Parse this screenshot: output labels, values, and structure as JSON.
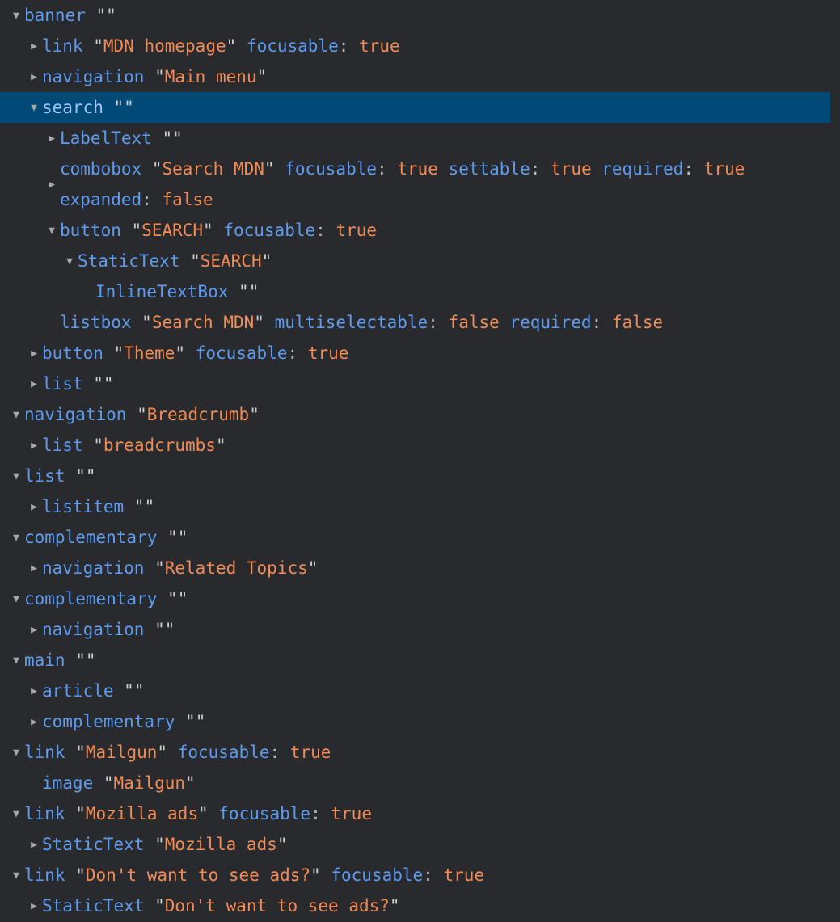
{
  "panel": {
    "name": "accessibility-tree-pane",
    "background_color": "#292a2d",
    "selected_row_color": "#004a77",
    "role_color": "#5e9cf0",
    "value_color": "#f28b54",
    "punctuation_color": "#cfcfcf"
  },
  "icons": {
    "expanded": "▼",
    "collapsed": "▶"
  },
  "quote": "\"",
  "colon": ":",
  "nodes": [
    {
      "toggle": "expanded",
      "indent": 0,
      "role": "banner",
      "name": "",
      "props": [],
      "selected": false,
      "wrapped": false
    },
    {
      "toggle": "collapsed",
      "indent": 1,
      "role": "link",
      "name": "MDN homepage",
      "props": [
        {
          "key": "focusable",
          "value": "true"
        }
      ],
      "selected": false,
      "wrapped": false
    },
    {
      "toggle": "collapsed",
      "indent": 1,
      "role": "navigation",
      "name": "Main menu",
      "props": [],
      "selected": false,
      "wrapped": false
    },
    {
      "toggle": "expanded",
      "indent": 1,
      "role": "search",
      "name": "",
      "props": [],
      "selected": true,
      "wrapped": false
    },
    {
      "toggle": "collapsed",
      "indent": 2,
      "role": "LabelText",
      "name": "",
      "props": [],
      "selected": false,
      "wrapped": false
    },
    {
      "toggle": "collapsed",
      "indent": 2,
      "role": "combobox",
      "name": "Search MDN",
      "props": [
        {
          "key": "focusable",
          "value": "true"
        },
        {
          "key": "settable",
          "value": "true"
        },
        {
          "key": "required",
          "value": "true"
        },
        {
          "key": "expanded",
          "value": "false"
        }
      ],
      "selected": false,
      "wrapped": true,
      "wrap_after_prop": 3
    },
    {
      "toggle": "expanded",
      "indent": 2,
      "role": "button",
      "name": "SEARCH",
      "props": [
        {
          "key": "focusable",
          "value": "true"
        }
      ],
      "selected": false,
      "wrapped": false
    },
    {
      "toggle": "expanded",
      "indent": 3,
      "role": "StaticText",
      "name": "SEARCH",
      "props": [],
      "selected": false,
      "wrapped": false
    },
    {
      "toggle": "none",
      "indent": 4,
      "role": "InlineTextBox",
      "name": "",
      "props": [],
      "selected": false,
      "wrapped": false
    },
    {
      "toggle": "none",
      "indent": 2,
      "role": "listbox",
      "name": "Search MDN",
      "props": [
        {
          "key": "multiselectable",
          "value": "false"
        },
        {
          "key": "required",
          "value": "false"
        }
      ],
      "selected": false,
      "wrapped": false
    },
    {
      "toggle": "collapsed",
      "indent": 1,
      "role": "button",
      "name": "Theme",
      "props": [
        {
          "key": "focusable",
          "value": "true"
        }
      ],
      "selected": false,
      "wrapped": false
    },
    {
      "toggle": "collapsed",
      "indent": 1,
      "role": "list",
      "name": "",
      "props": [],
      "selected": false,
      "wrapped": false
    },
    {
      "toggle": "expanded",
      "indent": 0,
      "role": "navigation",
      "name": "Breadcrumb",
      "props": [],
      "selected": false,
      "wrapped": false
    },
    {
      "toggle": "collapsed",
      "indent": 1,
      "role": "list",
      "name": "breadcrumbs",
      "props": [],
      "selected": false,
      "wrapped": false
    },
    {
      "toggle": "expanded",
      "indent": 0,
      "role": "list",
      "name": "",
      "props": [],
      "selected": false,
      "wrapped": false
    },
    {
      "toggle": "collapsed",
      "indent": 1,
      "role": "listitem",
      "name": "",
      "props": [],
      "selected": false,
      "wrapped": false
    },
    {
      "toggle": "expanded",
      "indent": 0,
      "role": "complementary",
      "name": "",
      "props": [],
      "selected": false,
      "wrapped": false
    },
    {
      "toggle": "collapsed",
      "indent": 1,
      "role": "navigation",
      "name": "Related Topics",
      "props": [],
      "selected": false,
      "wrapped": false
    },
    {
      "toggle": "expanded",
      "indent": 0,
      "role": "complementary",
      "name": "",
      "props": [],
      "selected": false,
      "wrapped": false
    },
    {
      "toggle": "collapsed",
      "indent": 1,
      "role": "navigation",
      "name": "",
      "props": [],
      "selected": false,
      "wrapped": false
    },
    {
      "toggle": "expanded",
      "indent": 0,
      "role": "main",
      "name": "",
      "props": [],
      "selected": false,
      "wrapped": false
    },
    {
      "toggle": "collapsed",
      "indent": 1,
      "role": "article",
      "name": "",
      "props": [],
      "selected": false,
      "wrapped": false
    },
    {
      "toggle": "collapsed",
      "indent": 1,
      "role": "complementary",
      "name": "",
      "props": [],
      "selected": false,
      "wrapped": false
    },
    {
      "toggle": "expanded",
      "indent": 0,
      "role": "link",
      "name": "Mailgun",
      "props": [
        {
          "key": "focusable",
          "value": "true"
        }
      ],
      "selected": false,
      "wrapped": false
    },
    {
      "toggle": "none",
      "indent": 1,
      "role": "image",
      "name": "Mailgun",
      "props": [],
      "selected": false,
      "wrapped": false
    },
    {
      "toggle": "expanded",
      "indent": 0,
      "role": "link",
      "name": "Mozilla ads",
      "props": [
        {
          "key": "focusable",
          "value": "true"
        }
      ],
      "selected": false,
      "wrapped": false
    },
    {
      "toggle": "collapsed",
      "indent": 1,
      "role": "StaticText",
      "name": "Mozilla ads",
      "props": [],
      "selected": false,
      "wrapped": false
    },
    {
      "toggle": "expanded",
      "indent": 0,
      "role": "link",
      "name": "Don't want to see ads?",
      "props": [
        {
          "key": "focusable",
          "value": "true"
        }
      ],
      "selected": false,
      "wrapped": false
    },
    {
      "toggle": "collapsed",
      "indent": 1,
      "role": "StaticText",
      "name": "Don't want to see ads?",
      "props": [],
      "selected": false,
      "wrapped": false
    }
  ]
}
